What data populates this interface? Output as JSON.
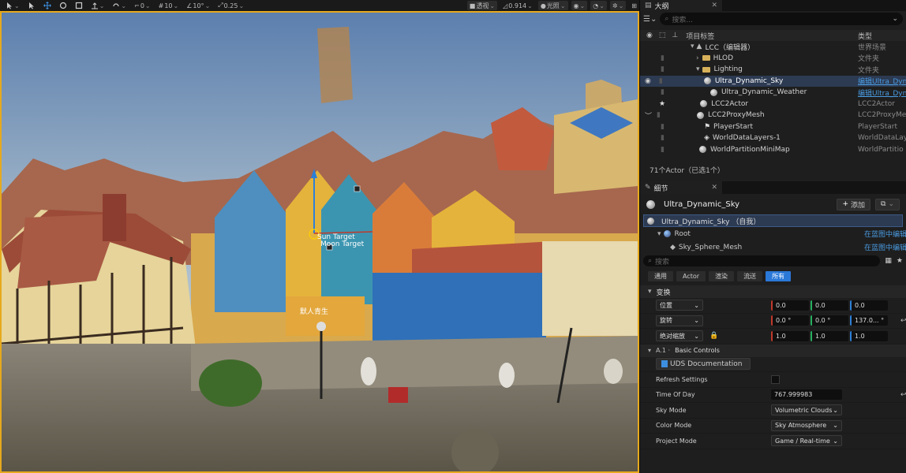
{
  "toolbar": {
    "angle_snap": "10°",
    "grid_snap": "10",
    "rot_snap": "0",
    "scale_snap": "0.25",
    "perspective": "透视",
    "fov": "0.914",
    "lit": "光照"
  },
  "viewport": {
    "sign_text": "默人青生",
    "gizmo_label_1": "Sun Target",
    "gizmo_label_2": "Moon Target"
  },
  "outliner": {
    "tab": "大纲",
    "search_placeholder": "搜索...",
    "col_label": "项目标签",
    "col_type": "类型",
    "rows": [
      {
        "name": "LCC（编辑器）",
        "type": "世界场景"
      },
      {
        "name": "HLOD",
        "type": "文件夹"
      },
      {
        "name": "Lighting",
        "type": "文件夹"
      },
      {
        "name": "Ultra_Dynamic_Sky",
        "type": "编辑Ultra_Dyn"
      },
      {
        "name": "Ultra_Dynamic_Weather",
        "type": "编辑Ultra_Dyn"
      },
      {
        "name": "LCC2Actor",
        "type": "LCC2Actor"
      },
      {
        "name": "LCC2ProxyMesh",
        "type": "LCC2ProxyMes"
      },
      {
        "name": "PlayerStart",
        "type": "PlayerStart"
      },
      {
        "name": "WorldDataLayers-1",
        "type": "WorldDataLaye"
      },
      {
        "name": "WorldPartitionMiniMap",
        "type": "WorldPartitio"
      }
    ],
    "status": "71个Actor（已选1个）"
  },
  "details": {
    "tab": "细节",
    "actor_name": "Ultra_Dynamic_Sky",
    "add_label": "添加",
    "components": [
      {
        "name": "Ultra_Dynamic_Sky （自我）",
        "link": ""
      },
      {
        "name": "Root",
        "link": "在蓝图中编辑"
      },
      {
        "name": "Sky_Sphere_Mesh",
        "link": "在蓝图中编辑"
      }
    ],
    "search_placeholder": "搜索",
    "filters": [
      "通用",
      "Actor",
      "渲染",
      "流送",
      "所有"
    ],
    "transform_header": "变换",
    "location_label": "位置",
    "rotation_label": "旋转",
    "scale_label": "绝对缩放",
    "location": [
      "0.0",
      "0.0",
      "0.0"
    ],
    "rotation": [
      "0.0 °",
      "0.0 °",
      "137.0... °"
    ],
    "scale": [
      "1.0",
      "1.0",
      "1.0"
    ],
    "basic_header_prefix": "A.1 ·",
    "basic_header": "Basic Controls",
    "uds_doc": "UDS Documentation",
    "props": [
      {
        "label": "Refresh Settings",
        "value": ""
      },
      {
        "label": "Time Of Day",
        "value": "767.999983"
      },
      {
        "label": "Sky Mode",
        "value": "Volumetric Clouds"
      },
      {
        "label": "Color Mode",
        "value": "Sky Atmosphere"
      },
      {
        "label": "Project Mode",
        "value": "Game / Real-time"
      }
    ]
  },
  "colors": {
    "accent": "#2a78d8",
    "viewport_border": "#e6a91e"
  }
}
